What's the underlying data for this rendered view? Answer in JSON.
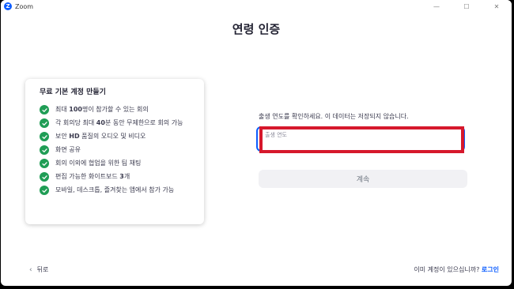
{
  "window": {
    "title": "Zoom",
    "logo_letter": "Z",
    "controls": [
      "—",
      "☐",
      "✕"
    ]
  },
  "page": {
    "title": "연령 인증"
  },
  "card": {
    "title": "무료 기본 계정 만들기",
    "features": [
      {
        "pre": "최대 ",
        "bold": "100",
        "post": "명이 참가할 수 있는 회의"
      },
      {
        "pre": "각 회의당 최대 ",
        "bold": "40",
        "post": "분 동안 무제한으로 회의 가능"
      },
      {
        "pre": "보안 ",
        "bold": "HD",
        "post": " 품질의 오디오 및 비디오"
      },
      {
        "pre": "화면 공유",
        "bold": "",
        "post": ""
      },
      {
        "pre": "회의 이외에 협업을 위한 팀 채팅",
        "bold": "",
        "post": ""
      },
      {
        "pre": "편집 가능한 화이트보드 ",
        "bold": "3",
        "post": "개"
      },
      {
        "pre": "모바일, 데스크톱, 즐겨찾는 앱에서 참가 가능",
        "bold": "",
        "post": ""
      }
    ]
  },
  "form": {
    "prompt": "출생 연도를 확인하세요. 이 데이터는 저장되지 않습니다.",
    "birth_year_placeholder": "출생 연도",
    "birth_year_value": "",
    "continue_label": "계속"
  },
  "footer": {
    "back_label": "뒤로",
    "back_icon": "chevron-left-icon",
    "account_prompt": "이미 계정이 있으십니까?",
    "login_label": "로그인"
  },
  "colors": {
    "brand_blue": "#0b5cff",
    "check_green": "#1f9d55",
    "highlight_red": "#d6182c"
  }
}
